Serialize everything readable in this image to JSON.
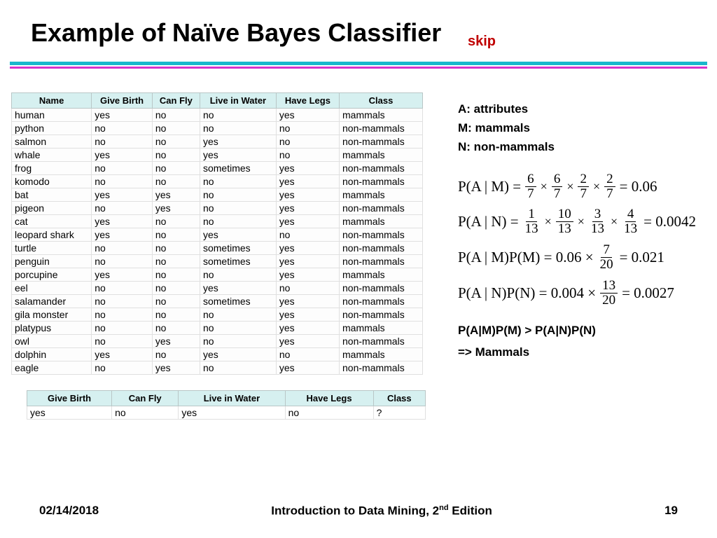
{
  "title": "Example of Naïve Bayes Classifier",
  "skip": "skip",
  "table": {
    "headers": [
      "Name",
      "Give Birth",
      "Can Fly",
      "Live in Water",
      "Have Legs",
      "Class"
    ],
    "rows": [
      [
        "human",
        "yes",
        "no",
        "no",
        "yes",
        "mammals"
      ],
      [
        "python",
        "no",
        "no",
        "no",
        "no",
        "non-mammals"
      ],
      [
        "salmon",
        "no",
        "no",
        "yes",
        "no",
        "non-mammals"
      ],
      [
        "whale",
        "yes",
        "no",
        "yes",
        "no",
        "mammals"
      ],
      [
        "frog",
        "no",
        "no",
        "sometimes",
        "yes",
        "non-mammals"
      ],
      [
        "komodo",
        "no",
        "no",
        "no",
        "yes",
        "non-mammals"
      ],
      [
        "bat",
        "yes",
        "yes",
        "no",
        "yes",
        "mammals"
      ],
      [
        "pigeon",
        "no",
        "yes",
        "no",
        "yes",
        "non-mammals"
      ],
      [
        "cat",
        "yes",
        "no",
        "no",
        "yes",
        "mammals"
      ],
      [
        "leopard shark",
        "yes",
        "no",
        "yes",
        "no",
        "non-mammals"
      ],
      [
        "turtle",
        "no",
        "no",
        "sometimes",
        "yes",
        "non-mammals"
      ],
      [
        "penguin",
        "no",
        "no",
        "sometimes",
        "yes",
        "non-mammals"
      ],
      [
        "porcupine",
        "yes",
        "no",
        "no",
        "yes",
        "mammals"
      ],
      [
        "eel",
        "no",
        "no",
        "yes",
        "no",
        "non-mammals"
      ],
      [
        "salamander",
        "no",
        "no",
        "sometimes",
        "yes",
        "non-mammals"
      ],
      [
        "gila monster",
        "no",
        "no",
        "no",
        "yes",
        "non-mammals"
      ],
      [
        "platypus",
        "no",
        "no",
        "no",
        "yes",
        "mammals"
      ],
      [
        "owl",
        "no",
        "yes",
        "no",
        "yes",
        "non-mammals"
      ],
      [
        "dolphin",
        "yes",
        "no",
        "yes",
        "no",
        "mammals"
      ],
      [
        "eagle",
        "no",
        "yes",
        "no",
        "yes",
        "non-mammals"
      ]
    ]
  },
  "query": {
    "headers": [
      "Give Birth",
      "Can Fly",
      "Live in Water",
      "Have Legs",
      "Class"
    ],
    "row": [
      "yes",
      "no",
      "yes",
      "no",
      "?"
    ]
  },
  "legend": {
    "a": "A: attributes",
    "m": "M: mammals",
    "n": "N: non-mammals"
  },
  "eq1": {
    "lhs": "P(A | M) =",
    "f1n": "6",
    "f1d": "7",
    "f2n": "6",
    "f2d": "7",
    "f3n": "2",
    "f3d": "7",
    "f4n": "2",
    "f4d": "7",
    "rhs": "= 0.06"
  },
  "eq2": {
    "lhs": "P(A | N) =",
    "f1n": "1",
    "f1d": "13",
    "f2n": "10",
    "f2d": "13",
    "f3n": "3",
    "f3d": "13",
    "f4n": "4",
    "f4d": "13",
    "rhs": "= 0.0042"
  },
  "eq3": {
    "lhs": "P(A | M)P(M) = 0.06 ×",
    "fn": "7",
    "fd": "20",
    "rhs": "= 0.021"
  },
  "eq4": {
    "lhs": "P(A | N)P(N) = 0.004 ×",
    "fn": "13",
    "fd": "20",
    "rhs": "= 0.0027"
  },
  "concl": {
    "line1": "P(A|M)P(M) > P(A|N)P(N)",
    "line2": "=> Mammals"
  },
  "footer": {
    "date": "02/14/2018",
    "book_pre": "Introduction to Data Mining, 2",
    "book_sup": "nd",
    "book_post": " Edition",
    "page": "19"
  },
  "sym": {
    "times": "×"
  }
}
